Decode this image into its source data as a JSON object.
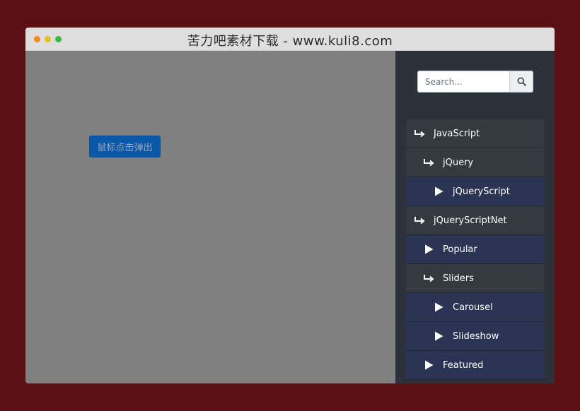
{
  "window": {
    "title": "苦力吧素材下载 - www.kuli8.com"
  },
  "content": {
    "popup_button_label": "鼠标点击弹出"
  },
  "sidebar": {
    "search": {
      "placeholder": "Search...",
      "value": ""
    },
    "menu": [
      {
        "label": "JavaScript",
        "icon": "return-arrow-icon"
      },
      {
        "label": "jQuery",
        "icon": "return-arrow-icon"
      },
      {
        "label": "jQueryScript",
        "icon": "play-icon"
      },
      {
        "label": "jQueryScriptNet",
        "icon": "return-arrow-icon"
      },
      {
        "label": "Popular",
        "icon": "play-icon"
      },
      {
        "label": "Sliders",
        "icon": "return-arrow-icon"
      },
      {
        "label": "Carousel",
        "icon": "play-icon"
      },
      {
        "label": "Slideshow",
        "icon": "play-icon"
      },
      {
        "label": "Featured",
        "icon": "play-icon"
      }
    ]
  },
  "colors": {
    "page_background": "#5a1013",
    "content_background": "#808080",
    "sidebar_background": "#2c323b",
    "menu_dark": "#343a40",
    "menu_blue": "#2b3452",
    "button_blue": "#0a58a8"
  }
}
